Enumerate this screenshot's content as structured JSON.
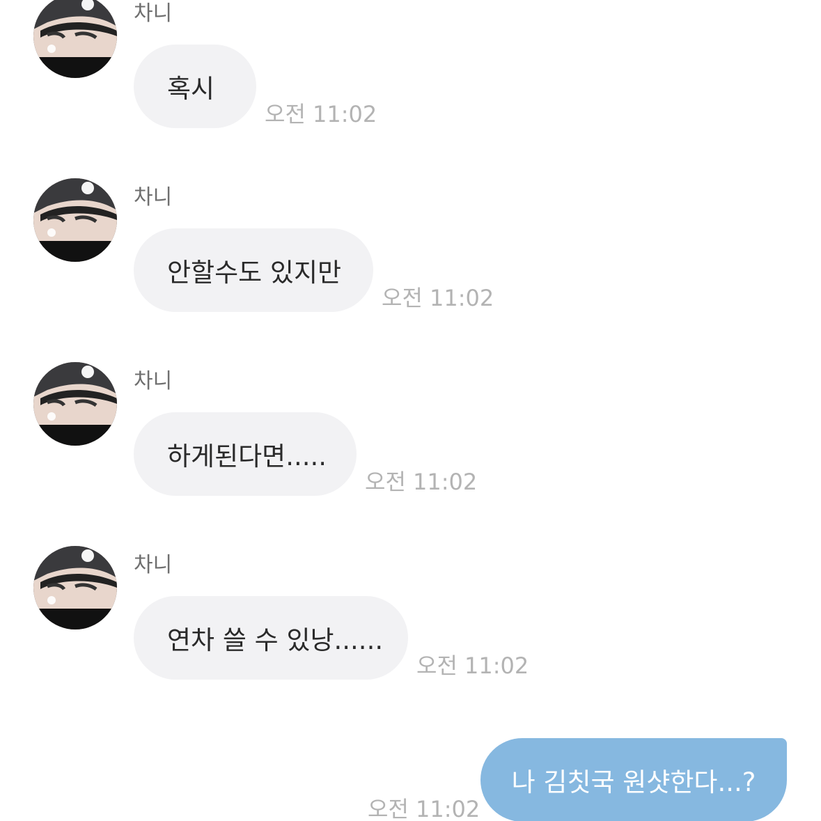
{
  "chat": {
    "messages_in": [
      {
        "sender": "차니",
        "text": "혹시",
        "time": "오전 11:02"
      },
      {
        "sender": "차니",
        "text": "안할수도 있지만",
        "time": "오전 11:02"
      },
      {
        "sender": "차니",
        "text": "하게된다면.....",
        "time": "오전 11:02"
      },
      {
        "sender": "차니",
        "text": "연차 쓸 수 있낭......",
        "time": "오전 11:02"
      }
    ],
    "message_out": {
      "text": "나 김칫국 원샷한다...?",
      "time": "오전 11:02"
    }
  },
  "colors": {
    "incoming_bubble": "#f2f2f4",
    "outgoing_bubble": "#86b8e0",
    "timestamp": "#b3b3b3",
    "sender_name": "#6f6f6f"
  },
  "icons": {
    "avatar": "profile-photo"
  }
}
